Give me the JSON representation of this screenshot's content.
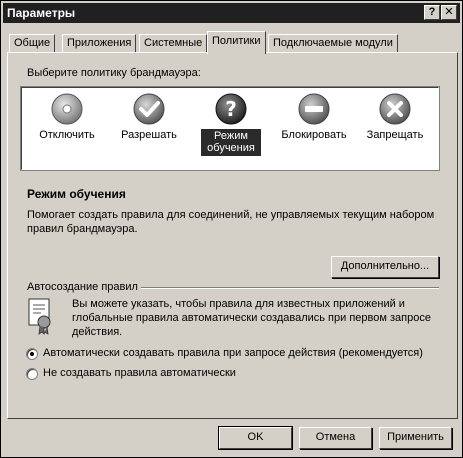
{
  "window": {
    "title": "Параметры",
    "help_button": "?",
    "close_button": "✕"
  },
  "tabs": [
    {
      "label": "Общие",
      "active": false
    },
    {
      "label": "Приложения",
      "active": false
    },
    {
      "label": "Системные",
      "active": false
    },
    {
      "label": "Политики",
      "active": true
    },
    {
      "label": "Подключаемые модули",
      "active": false
    }
  ],
  "policy": {
    "prompt": "Выберите политику брандмауэра:",
    "options": [
      {
        "label": "Отключить",
        "icon": "disable-icon",
        "selected": false
      },
      {
        "label": "Разрешать",
        "icon": "check-icon",
        "selected": false
      },
      {
        "label_line1": "Режим",
        "label_line2": "обучения",
        "icon": "question-icon",
        "selected": true
      },
      {
        "label": "Блокировать",
        "icon": "block-icon",
        "selected": false
      },
      {
        "label": "Запрещать",
        "icon": "deny-icon",
        "selected": false
      }
    ],
    "selected_title": "Режим обучения",
    "description_line1": "Помогает создать правила для соединений, не управляемых текущим набором",
    "description_line2": "правил брандмауэра.",
    "advanced_button": "Дополнительно..."
  },
  "autocreate": {
    "group_label": "Автосоздание правил",
    "info_line1": "Вы можете указать, чтобы правила для известных приложений и",
    "info_line2": "глобальные правила автоматически создавались при первом запросе",
    "info_line3": "действия.",
    "radio_auto": "Автоматически создавать правила при запросе действия (рекомендуется)",
    "radio_manual": "Не создавать правила автоматически",
    "selected": "auto"
  },
  "footer": {
    "ok": "OK",
    "cancel": "Отмена",
    "apply": "Применить"
  }
}
